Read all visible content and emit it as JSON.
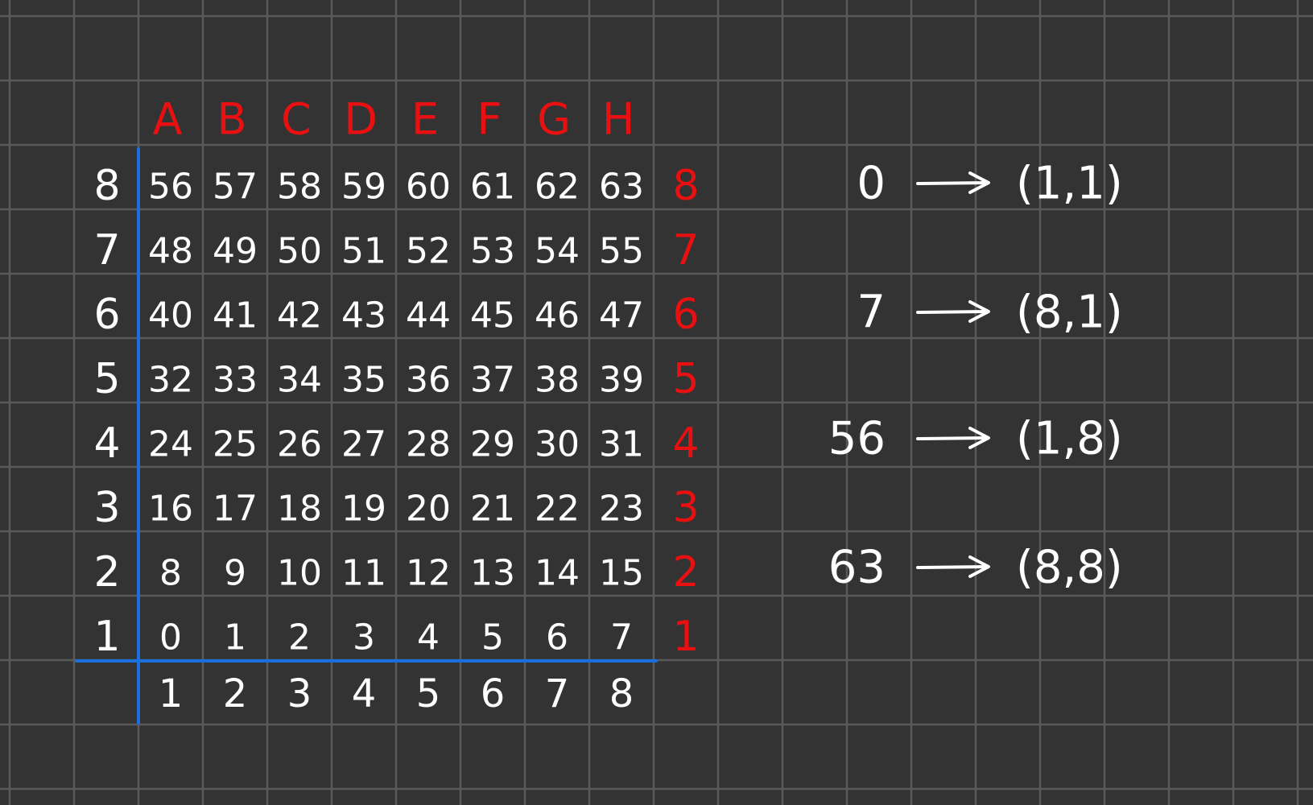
{
  "board": {
    "files": [
      "A",
      "B",
      "C",
      "D",
      "E",
      "F",
      "G",
      "H"
    ],
    "ranks_left": [
      "8",
      "7",
      "6",
      "5",
      "4",
      "3",
      "2",
      "1"
    ],
    "ranks_right": [
      "8",
      "7",
      "6",
      "5",
      "4",
      "3",
      "2",
      "1"
    ],
    "column_numbers": [
      "1",
      "2",
      "3",
      "4",
      "5",
      "6",
      "7",
      "8"
    ],
    "rows": [
      [
        "56",
        "57",
        "58",
        "59",
        "60",
        "61",
        "62",
        "63"
      ],
      [
        "48",
        "49",
        "50",
        "51",
        "52",
        "53",
        "54",
        "55"
      ],
      [
        "40",
        "41",
        "42",
        "43",
        "44",
        "45",
        "46",
        "47"
      ],
      [
        "32",
        "33",
        "34",
        "35",
        "36",
        "37",
        "38",
        "39"
      ],
      [
        "24",
        "25",
        "26",
        "27",
        "28",
        "29",
        "30",
        "31"
      ],
      [
        "16",
        "17",
        "18",
        "19",
        "20",
        "21",
        "22",
        "23"
      ],
      [
        "8",
        "9",
        "10",
        "11",
        "12",
        "13",
        "14",
        "15"
      ],
      [
        "0",
        "1",
        "2",
        "3",
        "4",
        "5",
        "6",
        "7"
      ]
    ]
  },
  "mappings": [
    {
      "index": "0",
      "coord": "(1,1)"
    },
    {
      "index": "7",
      "coord": "(8,1)"
    },
    {
      "index": "56",
      "coord": "(1,8)"
    },
    {
      "index": "63",
      "coord": "(8,8)"
    }
  ],
  "colors": {
    "background": "#333333",
    "grid": "#5a5a5a",
    "axis": "#1a6fe0",
    "files": "#e81010",
    "ink": "#ffffff"
  }
}
